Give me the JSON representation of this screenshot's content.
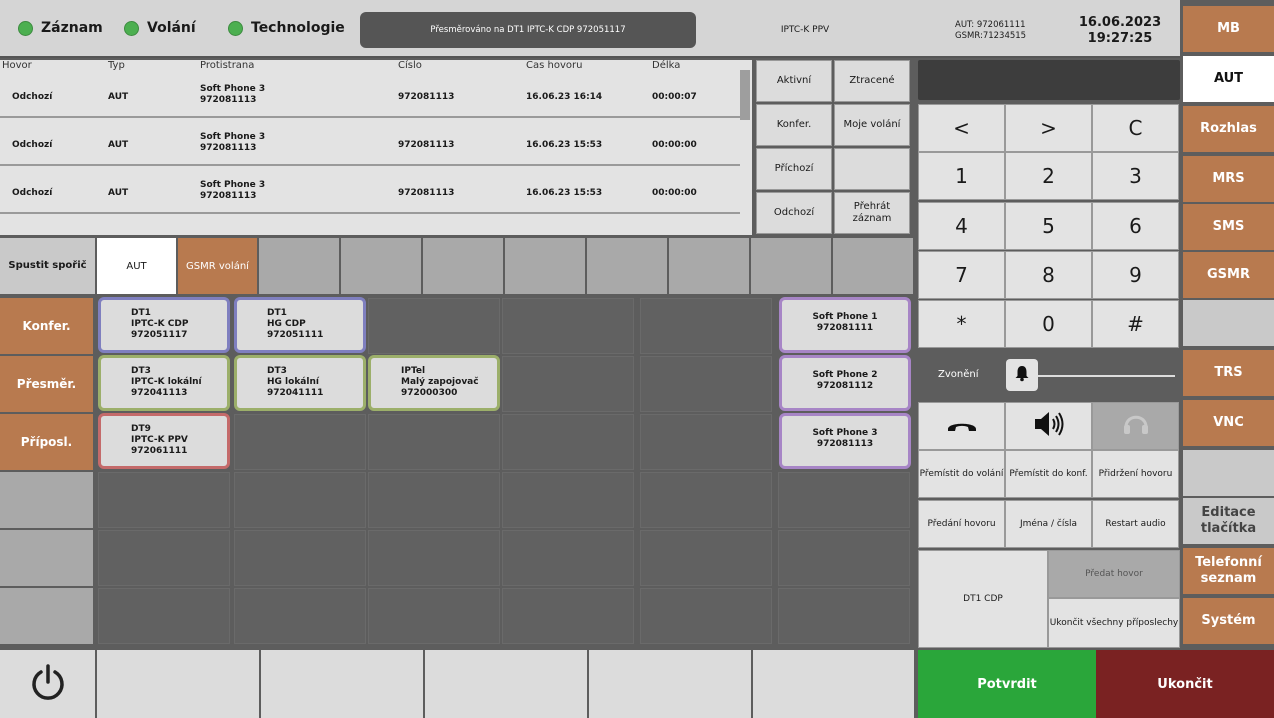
{
  "indicators": [
    {
      "label": "Záznam"
    },
    {
      "label": "Volání"
    },
    {
      "label": "Technologie"
    }
  ],
  "status": {
    "redirect": "Přesměrováno na DT1 IPTC-K CDP 972051117",
    "line": "IPTC-K PPV",
    "aut": "AUT: 972061111",
    "gsmr": "GSMR:71234515",
    "date": "16.06.2023",
    "time": "19:27:25"
  },
  "table": {
    "headers": [
      "Hovor",
      "Typ",
      "Protistrana",
      "Číslo",
      "Čas hovoru",
      "Délka"
    ],
    "rows": [
      {
        "direction": "Odchozí",
        "type": "AUT",
        "party": "Soft Phone 3",
        "party_num": "972081113",
        "number": "972081113",
        "time": "16.06.23 16:14",
        "length": "00:00:07"
      },
      {
        "direction": "Odchozí",
        "type": "AUT",
        "party": "Soft Phone 3",
        "party_num": "972081113",
        "number": "972081113",
        "time": "16.06.23 15:53",
        "length": "00:00:00"
      },
      {
        "direction": "Odchozí",
        "type": "AUT",
        "party": "Soft Phone 3",
        "party_num": "972081113",
        "number": "972081113",
        "time": "16.06.23 15:53",
        "length": "00:00:00"
      }
    ]
  },
  "filters": {
    "active": "Aktivní",
    "lost": "Ztracené",
    "conf": "Konfer.",
    "my_calls": "Moje volání",
    "incoming": "Příchozí",
    "outgoing": "Odchozí",
    "play": "Přehrát záznam"
  },
  "tabs": {
    "saver": "Spustit spořič",
    "aut": "AUT",
    "gsmr": "GSMR volání"
  },
  "left_actions": {
    "conf": "Konfer.",
    "redirect": "Přesměr.",
    "listen": "Příposl."
  },
  "contacts": {
    "dt1_cdp": {
      "l1": "DT1",
      "l2": "IPTC-K CDP",
      "l3": "972051117"
    },
    "dt1_hg": {
      "l1": "DT1",
      "l2": "HG CDP",
      "l3": "972051111"
    },
    "dt3_iptc": {
      "l1": "DT3",
      "l2": "IPTC-K lokální",
      "l3": "972041113"
    },
    "dt3_hg": {
      "l1": "DT3",
      "l2": "HG lokální",
      "l3": "972041111"
    },
    "iptel": {
      "l1": "IPTel",
      "l2": "Malý zapojovač",
      "l3": "972000300"
    },
    "dt9": {
      "l1": "DT9",
      "l2": "IPTC-K PPV",
      "l3": "972061111"
    },
    "sp1": {
      "l1": "Soft Phone 1",
      "l2": "972081111"
    },
    "sp2": {
      "l1": "Soft Phone 2",
      "l2": "972081112"
    },
    "sp3": {
      "l1": "Soft Phone 3",
      "l2": "972081113"
    }
  },
  "keypad": {
    "back": "<",
    "forward": ">",
    "clear": "C",
    "k1": "1",
    "k2": "2",
    "k3": "3",
    "k4": "4",
    "k5": "5",
    "k6": "6",
    "k7": "7",
    "k8": "8",
    "k9": "9",
    "star": "*",
    "k0": "0",
    "hash": "#"
  },
  "ringing": {
    "label": "Zvonění",
    "level_fraction": 0.0
  },
  "call_actions": {
    "move_call": "Přemístit do volání",
    "move_conf": "Přemístit do konf.",
    "hold": "Přidržení hovoru",
    "transfer": "Předání hovoru",
    "names": "Jména / čísla",
    "restart": "Restart audio",
    "dt1": "DT1 CDP",
    "pass": "Předat hovor",
    "end_all": "Ukončit všechny příposlechy"
  },
  "confirm": {
    "ok": "Potvrdit",
    "end": "Ukončit"
  },
  "right_menu": {
    "mb": "MB",
    "aut": "AUT",
    "rozhlas": "Rozhlas",
    "mrs": "MRS",
    "sms": "SMS",
    "gsmr": "GSMR",
    "trs": "TRS",
    "vnc": "VNC",
    "edit": "Editace tlačítka",
    "phonebook": "Telefonní seznam",
    "system": "Systém"
  },
  "colors": {
    "accent": "#b87a4f",
    "ok": "#2aa63a",
    "end": "#7a2222",
    "indicator": "#4caf50"
  }
}
